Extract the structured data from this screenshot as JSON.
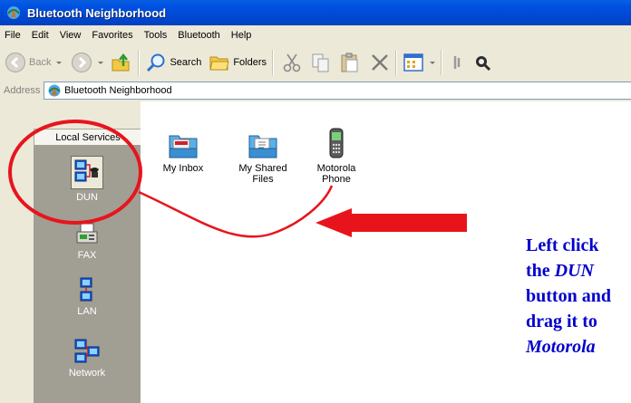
{
  "window": {
    "title": "Bluetooth Neighborhood"
  },
  "menubar": {
    "items": [
      "File",
      "Edit",
      "View",
      "Favorites",
      "Tools",
      "Bluetooth",
      "Help"
    ]
  },
  "toolbar": {
    "back_label": "Back",
    "search_label": "Search",
    "folders_label": "Folders"
  },
  "address": {
    "label": "Address",
    "value": "Bluetooth Neighborhood"
  },
  "left_pane": {
    "header": "Local Services",
    "services": [
      {
        "label": "DUN",
        "selected": true
      },
      {
        "label": "FAX"
      },
      {
        "label": "LAN"
      },
      {
        "label": "Network"
      }
    ]
  },
  "files": [
    {
      "label": "My Inbox"
    },
    {
      "label": "My Shared\nFiles"
    },
    {
      "label": "Motorola\nPhone"
    }
  ],
  "instruction": {
    "line1": "Left click",
    "line2_prefix": "the ",
    "line2_emph": "DUN",
    "line3": "button and",
    "line4": "drag it to",
    "line5_emph": "Motorola"
  },
  "colors": {
    "annotation_red": "#e8141c",
    "instruction_blue": "#0000cc",
    "titlebar_blue": "#0053e3"
  }
}
